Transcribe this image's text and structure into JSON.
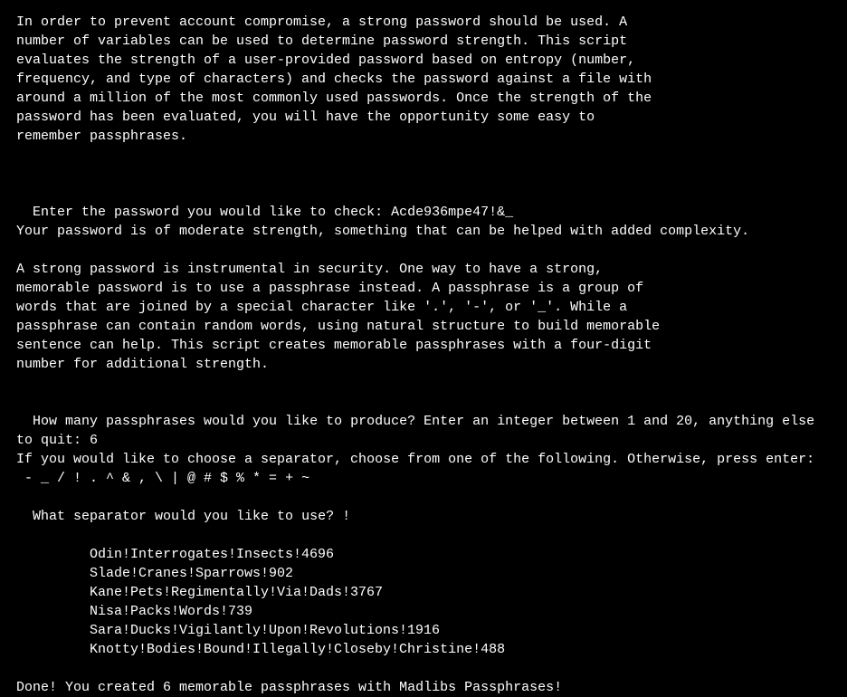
{
  "intro": {
    "line1": "In order to prevent account compromise, a strong password should be used. A",
    "line2": "number of variables can be used to determine password strength. This script",
    "line3": "evaluates the strength of a user-provided password based on entropy (number,",
    "line4": "frequency, and type of characters) and checks the password against a file with",
    "line5": "around a million of the most commonly used passwords. Once the strength of the",
    "line6": "password has been evaluated, you will have the opportunity some easy to",
    "line7": "remember passphrases."
  },
  "password_prompt": {
    "label": "Enter the password you would like to check: ",
    "input": "Acde936mpe47!&"
  },
  "password_result": "Your password is of moderate strength, something that can be helped with added complexity.",
  "passphrase_intro": {
    "line1": "A strong password is instrumental in security. One way to have a strong,",
    "line2": "memorable password is to use a passphrase instead. A passphrase is a group of",
    "line3": "words that are joined by a special character like '.', '-', or '_'. While a",
    "line4": "passphrase can contain random words, using natural structure to build memorable",
    "line5": "sentence can help. This script creates memorable passphrases with a four-digit",
    "line6": "number for additional strength."
  },
  "count_prompt": {
    "label": "How many passphrases would you like to produce? Enter an integer between 1 and 20, anything else to quit: ",
    "input": "6"
  },
  "separator_instruction": "If you would like to choose a separator, choose from one of the following. Otherwise, press enter:",
  "separator_options": " - _ / ! . ^ & , \\ | @ # $ % * = + ~",
  "separator_prompt": {
    "label": "What separator would you like to use? ",
    "input": "!"
  },
  "results": {
    "items": [
      "Odin!Interrogates!Insects!4696",
      "Slade!Cranes!Sparrows!902",
      "Kane!Pets!Regimentally!Via!Dads!3767",
      "Nisa!Packs!Words!739",
      "Sara!Ducks!Vigilantly!Upon!Revolutions!1916",
      "Knotty!Bodies!Bound!Illegally!Closeby!Christine!488"
    ]
  },
  "done_message": "Done! You created 6 memorable passphrases with Madlibs Passphrases!"
}
